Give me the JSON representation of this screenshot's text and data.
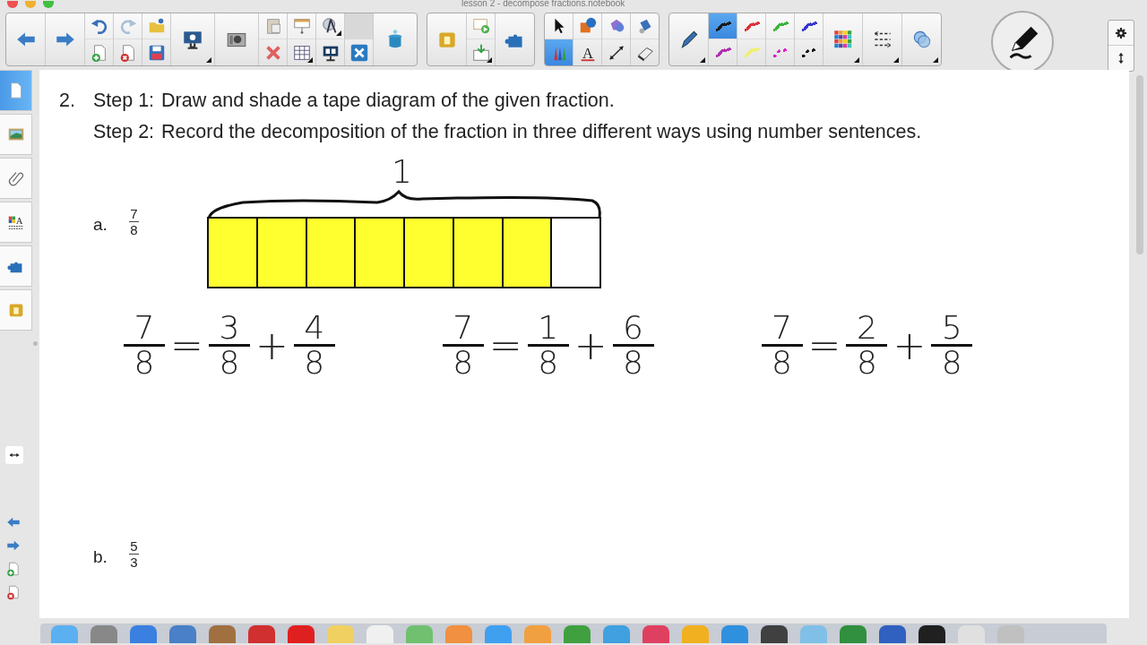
{
  "window": {
    "title": "lesson 2 - decompose fractions.notebook"
  },
  "toolbar": {
    "text_tool_glyph": "A",
    "tools": [
      {
        "selected": false
      },
      {
        "selected": false
      },
      {
        "selected": false
      },
      {
        "selected": false
      },
      {
        "selected": true
      },
      {
        "selected": false
      },
      {
        "selected": false
      },
      {
        "selected": false
      }
    ],
    "pen_styles": [
      {
        "kind": "solid",
        "color": "#1a1a1a",
        "selected": true
      },
      {
        "kind": "solid",
        "color": "#e0303a",
        "selected": false
      },
      {
        "kind": "solid",
        "color": "#3cb43c",
        "selected": false
      },
      {
        "kind": "solid",
        "color": "#3838d0",
        "selected": false
      },
      {
        "kind": "solid",
        "color": "#b030b0",
        "selected": false
      },
      {
        "kind": "highlighter",
        "color": "#f0f070",
        "selected": false
      },
      {
        "kind": "dashed",
        "color": "#e020d0",
        "selected": false
      },
      {
        "kind": "dashed",
        "color": "#1a1a1a",
        "selected": false
      }
    ]
  },
  "sidebar": {
    "properties_glyph": "A",
    "tabs": [
      {
        "selected": true
      },
      {
        "selected": false
      },
      {
        "selected": false
      },
      {
        "selected": false
      },
      {
        "selected": false
      },
      {
        "selected": false
      }
    ]
  },
  "page": {
    "number": "2.",
    "steps": [
      {
        "label": "Step 1:",
        "text": "Draw and shade a tape diagram of the given fraction."
      },
      {
        "label": "Step 2:",
        "text": "Record the decomposition of the fraction in three different ways using number sentences."
      }
    ],
    "parts": [
      {
        "letter": "a.",
        "fraction": {
          "num": "7",
          "den": "8"
        },
        "tape": {
          "whole_label": "1",
          "segments": [
            {
              "shaded": true
            },
            {
              "shaded": true
            },
            {
              "shaded": true
            },
            {
              "shaded": true
            },
            {
              "shaded": true
            },
            {
              "shaded": true
            },
            {
              "shaded": true
            },
            {
              "shaded": false
            }
          ]
        },
        "equations": [
          {
            "parts": [
              {
                "kind": "fraction",
                "num": "7",
                "den": "8"
              },
              {
                "kind": "symbol",
                "text": "="
              },
              {
                "kind": "fraction",
                "num": "3",
                "den": "8"
              },
              {
                "kind": "symbol",
                "text": "+"
              },
              {
                "kind": "fraction",
                "num": "4",
                "den": "8"
              }
            ]
          },
          {
            "parts": [
              {
                "kind": "fraction",
                "num": "7",
                "den": "8"
              },
              {
                "kind": "symbol",
                "text": "="
              },
              {
                "kind": "fraction",
                "num": "1",
                "den": "8"
              },
              {
                "kind": "symbol",
                "text": "+"
              },
              {
                "kind": "fraction",
                "num": "6",
                "den": "8"
              }
            ]
          },
          {
            "parts": [
              {
                "kind": "fraction",
                "num": "7",
                "den": "8"
              },
              {
                "kind": "symbol",
                "text": "="
              },
              {
                "kind": "fraction",
                "num": "2",
                "den": "8"
              },
              {
                "kind": "symbol",
                "text": "+"
              },
              {
                "kind": "fraction",
                "num": "5",
                "den": "8"
              }
            ]
          }
        ]
      },
      {
        "letter": "b.",
        "fraction": {
          "num": "5",
          "den": "3"
        }
      }
    ]
  }
}
